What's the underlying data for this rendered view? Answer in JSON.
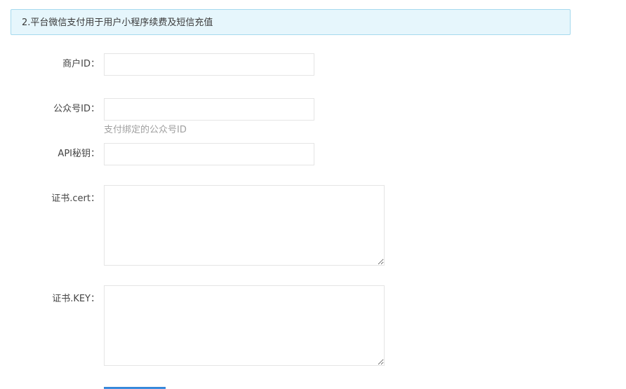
{
  "notice": {
    "text": "2.平台微信支付用于用户小程序续费及短信充值"
  },
  "form": {
    "merchant_id": {
      "label": "商户ID：",
      "value": "",
      "placeholder": ""
    },
    "official_account_id": {
      "label": "公众号ID：",
      "value": "",
      "placeholder": "",
      "help": "支付绑定的公众号ID"
    },
    "api_key": {
      "label": "API秘钥：",
      "value": "",
      "placeholder": ""
    },
    "cert": {
      "label": "证书.cert：",
      "value": ""
    },
    "key": {
      "label": "证书.KEY：",
      "value": ""
    }
  },
  "colors": {
    "notice_bg": "#e6f6fc",
    "notice_border": "#a5d9ee",
    "help_text": "#a0a0a0",
    "button_primary": "#3d8ee0"
  }
}
